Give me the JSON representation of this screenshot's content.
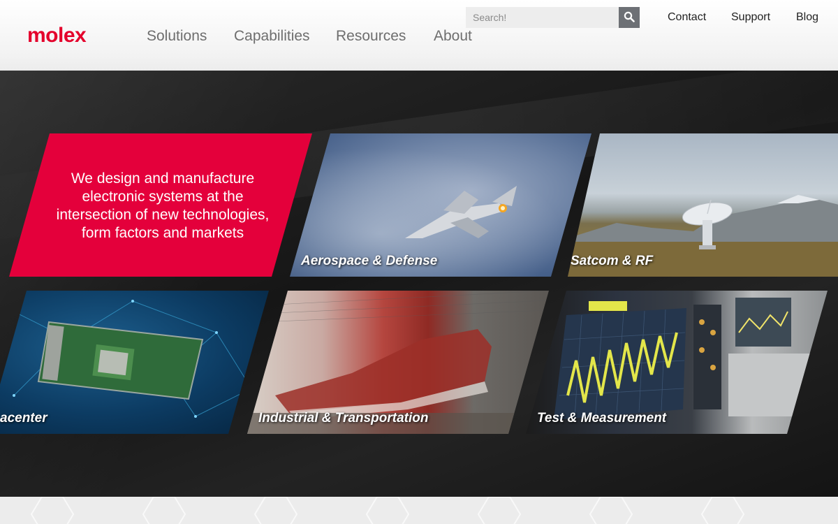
{
  "brand": {
    "logo_text": "molex",
    "accent_color": "#e4002b"
  },
  "main_nav": {
    "items": [
      {
        "label": "Solutions"
      },
      {
        "label": "Capabilities"
      },
      {
        "label": "Resources"
      },
      {
        "label": "About"
      }
    ]
  },
  "search": {
    "placeholder": "Search!",
    "icon": "search-icon"
  },
  "utility_nav": {
    "items": [
      {
        "label": "Contact"
      },
      {
        "label": "Support"
      },
      {
        "label": "Blog"
      }
    ]
  },
  "hero": {
    "tagline": "We design and manufacture electronic systems at the intersection of new technologies, form factors and markets",
    "tiles": [
      {
        "label": "Aerospace & Defense"
      },
      {
        "label": "Satcom & RF"
      },
      {
        "label": "Datacenter",
        "visible_label": "acenter"
      },
      {
        "label": "Industrial & Transportation"
      },
      {
        "label": "Test & Measurement"
      }
    ]
  }
}
